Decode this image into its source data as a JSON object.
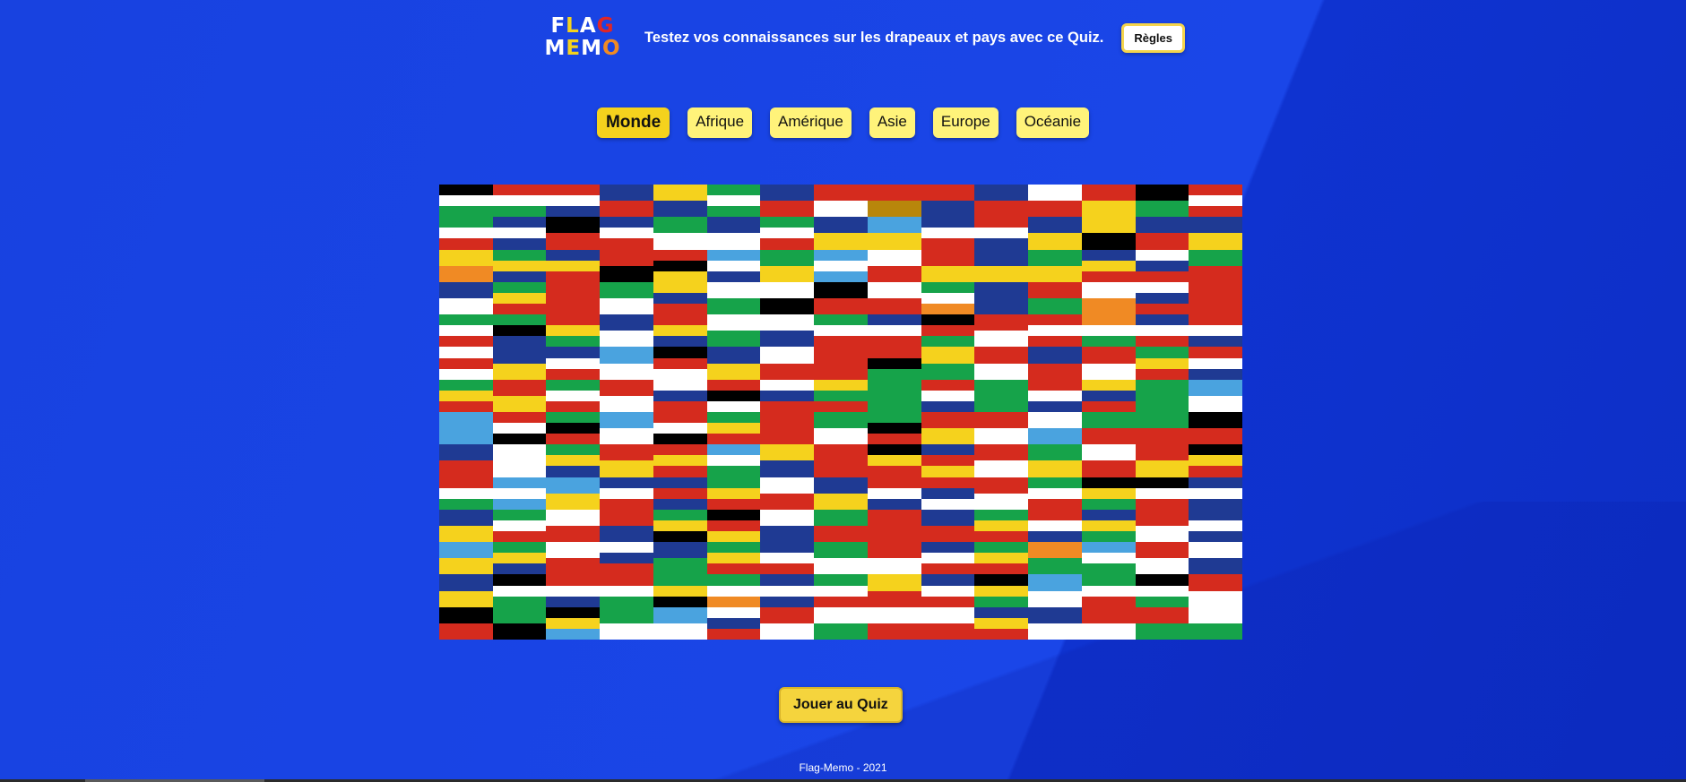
{
  "colors": {
    "background": "#1a45e6",
    "accent_yellow": "#f5d21d",
    "button_yellow": "#fff37a"
  },
  "header": {
    "logo_line1": [
      "F",
      "L",
      "A",
      "G"
    ],
    "logo_line2": [
      "M",
      "E",
      "M",
      "O"
    ],
    "logo_colors": [
      "#ffffff",
      "#f5d21d",
      "#ffffff",
      "#e02626",
      "#ffffff",
      "#f5d21d",
      "#ffffff",
      "#f08a24"
    ],
    "tagline": "Testez vos connaissances sur les drapeaux et pays avec ce Quiz.",
    "rules_label": "Règles"
  },
  "regions": [
    {
      "label": "Monde",
      "active": true
    },
    {
      "label": "Afrique",
      "active": false
    },
    {
      "label": "Amérique",
      "active": false
    },
    {
      "label": "Asie",
      "active": false
    },
    {
      "label": "Europe",
      "active": false
    },
    {
      "label": "Océanie",
      "active": false
    }
  ],
  "flags": [
    [
      "#000000",
      "#ffffff",
      "#16a34a"
    ],
    [
      "#d52b1e",
      "#ffffff",
      "#16a34a"
    ],
    [
      "#d52b1e",
      "#ffffff",
      "#1f3a93"
    ],
    [
      "#1f3a93",
      "#d52b1e"
    ],
    [
      "#f5d21d",
      "#1f3a93"
    ],
    [
      "#16a34a",
      "#ffffff",
      "#16a34a"
    ],
    [
      "#1f3a93",
      "#d52b1e"
    ],
    [
      "#d52b1e",
      "#ffffff"
    ],
    [
      "#d52b1e",
      "#b8860b"
    ],
    [
      "#d52b1e",
      "#1f3a93"
    ],
    [
      "#1f3a93",
      "#d52b1e"
    ],
    [
      "#ffffff",
      "#d52b1e"
    ],
    [
      "#d52b1e",
      "#f5d21d"
    ],
    [
      "#000000",
      "#16a34a"
    ],
    [
      "#d52b1e",
      "#ffffff",
      "#d52b1e"
    ],
    [
      "#16a34a",
      "#ffffff",
      "#d52b1e"
    ],
    [
      "#1f3a93",
      "#ffffff",
      "#1f3a93"
    ],
    [
      "#000000",
      "#d52b1e"
    ],
    [
      "#1f3a93",
      "#ffffff",
      "#d52b1e"
    ],
    [
      "#16a34a",
      "#ffffff"
    ],
    [
      "#1f3a93",
      "#ffffff"
    ],
    [
      "#16a34a",
      "#ffffff",
      "#d52b1e"
    ],
    [
      "#1f3a93",
      "#f5d21d"
    ],
    [
      "#4aa3df",
      "#f5d21d"
    ],
    [
      "#1f3a93",
      "#ffffff",
      "#d52b1e"
    ],
    [
      "#d52b1e",
      "#ffffff",
      "#1f3a93"
    ],
    [
      "#1f3a93",
      "#f5d21d"
    ],
    [
      "#f5d21d",
      "#000000"
    ],
    [
      "#1f3a93",
      "#d52b1e"
    ],
    [
      "#1f3a93",
      "#f5d21d"
    ],
    [
      "#f5d21d",
      "#f08a24"
    ],
    [
      "#16a34a",
      "#f5d21d",
      "#1f3a93"
    ],
    [
      "#1f3a93",
      "#f5d21d",
      "#d52b1e"
    ],
    [
      "#d52b1e",
      "#000000"
    ],
    [
      "#d52b1e",
      "#000000",
      "#f5d21d"
    ],
    [
      "#4aa3df",
      "#ffffff",
      "#1f3a93"
    ],
    [
      "#16a34a",
      "#f5d21d"
    ],
    [
      "#4aa3df",
      "#ffffff",
      "#4aa3df"
    ],
    [
      "#ffffff",
      "#d52b1e"
    ],
    [
      "#d52b1e",
      "#f5d21d"
    ],
    [
      "#1f3a93",
      "#f5d21d"
    ],
    [
      "#16a34a",
      "#f5d21d"
    ],
    [
      "#1f3a93",
      "#f5d21d",
      "#d52b1e"
    ],
    [
      "#ffffff",
      "#1f3a93",
      "#d52b1e"
    ],
    [
      "#16a34a",
      "#d52b1e"
    ],
    [
      "#1f3a93",
      "#ffffff"
    ],
    [
      "#16a34a",
      "#f5d21d",
      "#d52b1e"
    ],
    [
      "#d52b1e"
    ],
    [
      "#16a34a",
      "#ffffff"
    ],
    [
      "#f5d21d",
      "#1f3a93",
      "#d52b1e"
    ],
    [
      "#ffffff",
      "#16a34a"
    ],
    [
      "#ffffff",
      "#000000"
    ],
    [
      "#000000",
      "#d52b1e"
    ],
    [
      "#ffffff",
      "#d52b1e"
    ],
    [
      "#16a34a",
      "#ffffff",
      "#f08a24"
    ],
    [
      "#1f3a93"
    ],
    [
      "#d52b1e",
      "#16a34a"
    ],
    [
      "#ffffff",
      "#f08a24"
    ],
    [
      "#ffffff",
      "#1f3a93",
      "#d52b1e"
    ],
    [
      "#d52b1e"
    ],
    [
      "#16a34a",
      "#ffffff",
      "#d52b1e"
    ],
    [
      "#16a34a",
      "#000000",
      "#1f3a93"
    ],
    [
      "#d52b1e",
      "#f5d21d",
      "#16a34a"
    ],
    [
      "#1f3a93",
      "#ffffff"
    ],
    [
      "#d52b1e",
      "#f5d21d",
      "#1f3a93"
    ],
    [
      "#ffffff",
      "#16a34a"
    ],
    [
      "#ffffff",
      "#1f3a93"
    ],
    [
      "#16a34a",
      "#ffffff",
      "#d52b1e"
    ],
    [
      "#1f3a93",
      "#ffffff",
      "#d52b1e"
    ],
    [
      "#000000",
      "#d52b1e",
      "#16a34a"
    ],
    [
      "#d52b1e",
      "#ffffff"
    ],
    [
      "#d52b1e",
      "#ffffff",
      "#d52b1e"
    ],
    [
      "#f08a24",
      "#ffffff",
      "#16a34a"
    ],
    [
      "#1f3a93",
      "#ffffff",
      "#d52b1e"
    ],
    [
      "#d52b1e",
      "#ffffff",
      "#1f3a93"
    ],
    [
      "#ffffff",
      "#d52b1e",
      "#ffffff"
    ],
    [
      "#1f3a93",
      "#f5d21d"
    ],
    [
      "#1f3a93",
      "#ffffff",
      "#d52b1e"
    ],
    [
      "#4aa3df",
      "#ffffff"
    ],
    [
      "#000000",
      "#d52b1e",
      "#ffffff"
    ],
    [
      "#1f3a93",
      "#f5d21d"
    ],
    [
      "#ffffff",
      "#d52b1e"
    ],
    [
      "#d52b1e"
    ],
    [
      "#d52b1e",
      "#000000",
      "#16a34a"
    ],
    [
      "#f5d21d",
      "#16a34a"
    ],
    [
      "#d52b1e",
      "#ffffff"
    ],
    [
      "#1f3a93",
      "#d52b1e"
    ],
    [
      "#d52b1e",
      "#ffffff"
    ],
    [
      "#16a34a",
      "#f5d21d",
      "#d52b1e"
    ],
    [
      "#d52b1e",
      "#ffffff",
      "#1f3a93"
    ],
    [
      "#16a34a",
      "#f5d21d",
      "#d52b1e"
    ],
    [
      "#d52b1e",
      "#f5d21d"
    ],
    [
      "#16a34a",
      "#ffffff",
      "#d52b1e"
    ],
    [
      "#d52b1e",
      "#ffffff"
    ],
    [
      "#ffffff",
      "#1f3a93",
      "#d52b1e"
    ],
    [
      "#d52b1e",
      "#000000",
      "#ffffff"
    ],
    [
      "#ffffff",
      "#1f3a93",
      "#d52b1e"
    ],
    [
      "#f5d21d",
      "#16a34a",
      "#d52b1e"
    ],
    [
      "#16a34a"
    ],
    [
      "#d52b1e",
      "#ffffff",
      "#1f3a93"
    ],
    [
      "#16a34a"
    ],
    [
      "#d52b1e",
      "#ffffff",
      "#1f3a93"
    ],
    [
      "#f5d21d",
      "#1f3a93",
      "#d52b1e"
    ],
    [
      "#16a34a"
    ],
    [
      "#4aa3df",
      "#ffffff"
    ],
    [
      "#4aa3df"
    ],
    [
      "#d52b1e",
      "#ffffff",
      "#000000"
    ],
    [
      "#16a34a",
      "#000000",
      "#d52b1e"
    ],
    [
      "#4aa3df",
      "#ffffff"
    ],
    [
      "#d52b1e",
      "#ffffff",
      "#000000"
    ],
    [
      "#16a34a",
      "#f5d21d",
      "#d52b1e"
    ],
    [
      "#d52b1e"
    ],
    [
      "#16a34a",
      "#ffffff"
    ],
    [
      "#16a34a",
      "#000000",
      "#d52b1e"
    ],
    [
      "#d52b1e",
      "#f5d21d"
    ],
    [
      "#d52b1e",
      "#ffffff"
    ],
    [
      "#ffffff",
      "#4aa3df"
    ],
    [
      "#16a34a",
      "#d52b1e"
    ],
    [
      "#16a34a",
      "#d52b1e"
    ],
    [
      "#000000",
      "#d52b1e"
    ],
    [
      "#1f3a93",
      "#d52b1e"
    ],
    [
      "#ffffff"
    ],
    [
      "#16a34a",
      "#f5d21d",
      "#1f3a93"
    ],
    [
      "#d52b1e",
      "#f5d21d"
    ],
    [
      "#d52b1e",
      "#f5d21d",
      "#d52b1e"
    ],
    [
      "#4aa3df",
      "#ffffff",
      "#16a34a"
    ],
    [
      "#f5d21d",
      "#1f3a93"
    ],
    [
      "#d52b1e"
    ],
    [
      "#000000",
      "#f5d21d",
      "#d52b1e"
    ],
    [
      "#1f3a93",
      "#d52b1e",
      "#f5d21d"
    ],
    [
      "#d52b1e",
      "#ffffff"
    ],
    [
      "#16a34a",
      "#f5d21d"
    ],
    [
      "#ffffff",
      "#d52b1e"
    ],
    [
      "#d52b1e",
      "#f5d21d"
    ],
    [
      "#000000",
      "#f5d21d",
      "#d52b1e"
    ],
    [
      "#d52b1e",
      "#ffffff",
      "#16a34a"
    ],
    [
      "#4aa3df",
      "#ffffff",
      "#4aa3df"
    ],
    [
      "#4aa3df",
      "#f5d21d"
    ],
    [
      "#1f3a93",
      "#ffffff",
      "#d52b1e"
    ],
    [
      "#1f3a93",
      "#d52b1e",
      "#1f3a93"
    ],
    [
      "#16a34a",
      "#f5d21d",
      "#d52b1e"
    ],
    [
      "#ffffff",
      "#d52b1e"
    ],
    [
      "#1f3a93",
      "#f5d21d"
    ],
    [
      "#d52b1e",
      "#ffffff",
      "#1f3a93"
    ],
    [
      "#d52b1e",
      "#1f3a93",
      "#ffffff"
    ],
    [
      "#d52b1e",
      "#ffffff"
    ],
    [
      "#16a34a",
      "#ffffff",
      "#d52b1e"
    ],
    [
      "#000000",
      "#f5d21d",
      "#16a34a"
    ],
    [
      "#000000",
      "#ffffff",
      "#d52b1e"
    ],
    [
      "#1f3a93",
      "#ffffff",
      "#1f3a93"
    ],
    [
      "#1f3a93",
      "#f5d21d"
    ],
    [
      "#16a34a",
      "#ffffff",
      "#d52b1e"
    ],
    [
      "#ffffff",
      "#d52b1e"
    ],
    [
      "#d52b1e",
      "#1f3a93"
    ],
    [
      "#16a34a",
      "#f5d21d",
      "#000000"
    ],
    [
      "#000000",
      "#d52b1e",
      "#f5d21d"
    ],
    [
      "#ffffff",
      "#1f3a93"
    ],
    [
      "#16a34a",
      "#d52b1e"
    ],
    [
      "#d52b1e"
    ],
    [
      "#1f3a93",
      "#d52b1e"
    ],
    [
      "#16a34a",
      "#f5d21d",
      "#d52b1e"
    ],
    [
      "#d52b1e",
      "#ffffff",
      "#1f3a93"
    ],
    [
      "#1f3a93",
      "#f5d21d",
      "#16a34a"
    ],
    [
      "#d52b1e",
      "#ffffff"
    ],
    [
      "#1f3a93",
      "#ffffff",
      "#1f3a93"
    ],
    [
      "#4aa3df",
      "#f5d21d"
    ],
    [
      "#16a34a",
      "#f5d21d",
      "#1f3a93"
    ],
    [
      "#ffffff",
      "#d52b1e"
    ],
    [
      "#ffffff",
      "#1f3a93",
      "#d52b1e"
    ],
    [
      "#1f3a93",
      "#16a34a"
    ],
    [
      "#16a34a",
      "#f5d21d",
      "#d52b1e"
    ],
    [
      "#1f3a93",
      "#ffffff",
      "#d52b1e"
    ],
    [
      "#16a34a",
      "#ffffff"
    ],
    [
      "#d52b1e",
      "#ffffff"
    ],
    [
      "#1f3a93",
      "#ffffff",
      "#d52b1e"
    ],
    [
      "#16a34a",
      "#f5d21d",
      "#d52b1e"
    ],
    [
      "#f08a24",
      "#16a34a"
    ],
    [
      "#4aa3df",
      "#ffffff",
      "#16a34a"
    ],
    [
      "#d52b1e",
      "#ffffff"
    ],
    [
      "#ffffff",
      "#1f3a93"
    ],
    [
      "#1f3a93",
      "#f5d21d"
    ],
    [
      "#000000",
      "#ffffff",
      "#16a34a"
    ],
    [
      "#d52b1e",
      "#ffffff",
      "#1f3a93"
    ],
    [
      "#d52b1e",
      "#ffffff",
      "#16a34a"
    ],
    [
      "#16a34a",
      "#f5d21d",
      "#000000"
    ],
    [
      "#16a34a",
      "#ffffff",
      "#f08a24"
    ],
    [
      "#1f3a93",
      "#ffffff",
      "#1f3a93"
    ],
    [
      "#16a34a",
      "#ffffff",
      "#d52b1e"
    ],
    [
      "#f5d21d",
      "#d52b1e"
    ],
    [
      "#1f3a93",
      "#ffffff",
      "#d52b1e"
    ],
    [
      "#000000",
      "#f5d21d",
      "#16a34a"
    ],
    [
      "#4aa3df",
      "#ffffff"
    ],
    [
      "#16a34a",
      "#ffffff",
      "#d52b1e"
    ],
    [
      "#000000",
      "#ffffff",
      "#16a34a"
    ],
    [
      "#d52b1e",
      "#ffffff"
    ],
    [
      "#000000",
      "#d52b1e"
    ],
    [
      "#16a34a",
      "#000000"
    ],
    [
      "#000000",
      "#f5d21d",
      "#4aa3df"
    ],
    [
      "#16a34a",
      "#ffffff"
    ],
    [
      "#4aa3df",
      "#ffffff"
    ],
    [
      "#ffffff",
      "#1f3a93",
      "#d52b1e"
    ],
    [
      "#d52b1e",
      "#ffffff"
    ],
    [
      "#ffffff",
      "#16a34a"
    ],
    [
      "#ffffff",
      "#d52b1e"
    ],
    [
      "#ffffff",
      "#d52b1e"
    ],
    [
      "#1f3a93",
      "#f5d21d",
      "#d52b1e"
    ],
    [
      "#1f3a93",
      "#ffffff"
    ],
    [
      "#d52b1e",
      "#ffffff"
    ],
    [
      "#d52b1e",
      "#16a34a"
    ],
    [
      "#ffffff",
      "#16a34a"
    ]
  ],
  "play_label": "Jouer au Quiz",
  "footer": "Flag-Memo - 2021"
}
